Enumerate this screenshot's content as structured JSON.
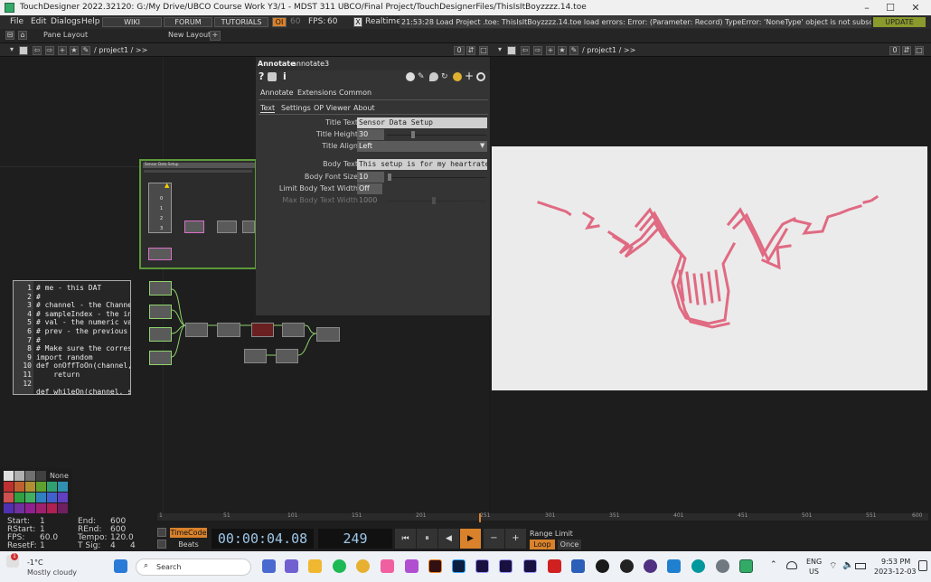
{
  "window": {
    "title": "TouchDesigner 2022.32120: G:/My Drive/UBCO Course Work Y3/1 - MDST 311 UBCO/Final Project/TouchDesignerFiles/ThisIsItBoyzzzz.14.toe"
  },
  "menubar": {
    "file": "File",
    "edit": "Edit",
    "dialogs": "Dialogs",
    "help": "Help",
    "wiki": "WIKI",
    "forum": "FORUM",
    "tutorials": "TUTORIALS",
    "oi": "OI",
    "oi_num": "60",
    "fps_label": "FPS:",
    "fps_value": "60",
    "realtime_mark": "X",
    "realtime": "Realtime",
    "status": "21:53:28 Load Project .toe: ThisIsItBoyzzzz.14.toe load errors:    Error: (Parameter: Record)  TypeError: 'NoneType' object is not subscriptab",
    "update": "UPDATE"
  },
  "layoutbar": {
    "pane_layout": "Pane Layout",
    "new_layout": "New Layout",
    "add": "+"
  },
  "pathbar_left": {
    "path": "/ project1 / >>",
    "zero": "0"
  },
  "pathbar_right": {
    "path": "/ project1 / >>",
    "zero": "0"
  },
  "textdat": {
    "line_numbers": "1\n2\n3\n4\n5\n6\n7\n8\n9\n10\n11\n12",
    "comments": "# me - this DAT\n#\n# channel - the Channel\n# sampleIndex - the inde\n# val - the numeric valu\n# prev - the previous sa\n#\n# Make sure the correspo",
    "code1": "import random",
    "code2": "def onOffToOn(channel, s",
    "code3": "    return",
    "code4": "def whileOn(channel, sam"
  },
  "annotate_node": {
    "title": "Sensor Data Setup",
    "num0": "0",
    "num1": "1",
    "num2": "2",
    "num3": "3"
  },
  "params": {
    "op_type": "Annotate",
    "op_name": "annotate3",
    "icon_help": "?",
    "icon_info": "i",
    "tabs": [
      "Annotate",
      "Extensions",
      "Common"
    ],
    "subtabs": [
      "Text",
      "Settings",
      "OP Viewer",
      "About"
    ],
    "title_text_label": "Title Text",
    "title_text_value": "Sensor Data Setup",
    "title_height_label": "Title Height",
    "title_height_value": "30",
    "title_align_label": "Title Align",
    "title_align_value": "Left",
    "body_text_label": "Body Text",
    "body_text_value": "This setup is for my heartrate",
    "body_font_size_label": "Body Font Size",
    "body_font_size_value": "10",
    "limit_body_label": "Limit Body Text Width",
    "limit_body_value": "Off",
    "max_body_label": "Max Body Text Width",
    "max_body_value": "1000"
  },
  "palette": {
    "none": "None"
  },
  "timeline": {
    "start_label": "Start:",
    "start": "1",
    "rstart_label": "RStart:",
    "rstart": "1",
    "fps_label": "FPS:",
    "fps": "60.0",
    "resetf_label": "ResetF:",
    "resetf": "1",
    "end_label": "End:",
    "end": "600",
    "rend_label": "REnd:",
    "rend": "600",
    "tempo_label": "Tempo:",
    "tempo": "120.0",
    "tsig_label": "T Sig:",
    "tsig_a": "4",
    "tsig_b": "4",
    "timecode": "TimeCode",
    "beats": "Beats",
    "time": "00:00:04.08",
    "frame": "249",
    "range_limit": "Range Limit",
    "loop": "Loop",
    "once": "Once",
    "ruler": [
      "1",
      "51",
      "101",
      "151",
      "201",
      "251",
      "301",
      "351",
      "401",
      "451",
      "501",
      "551",
      "600"
    ]
  },
  "taskbar": {
    "temp": "-1°C",
    "weather": "Mostly cloudy",
    "search": "Search",
    "lang1": "ENG",
    "lang2": "US",
    "time": "9:53 PM",
    "date": "2023-12-03",
    "notif": "1"
  },
  "colors": {
    "accent_orange": "#d9822b",
    "annotate_border": "#5c9a3a",
    "wave": "#e06a82"
  }
}
